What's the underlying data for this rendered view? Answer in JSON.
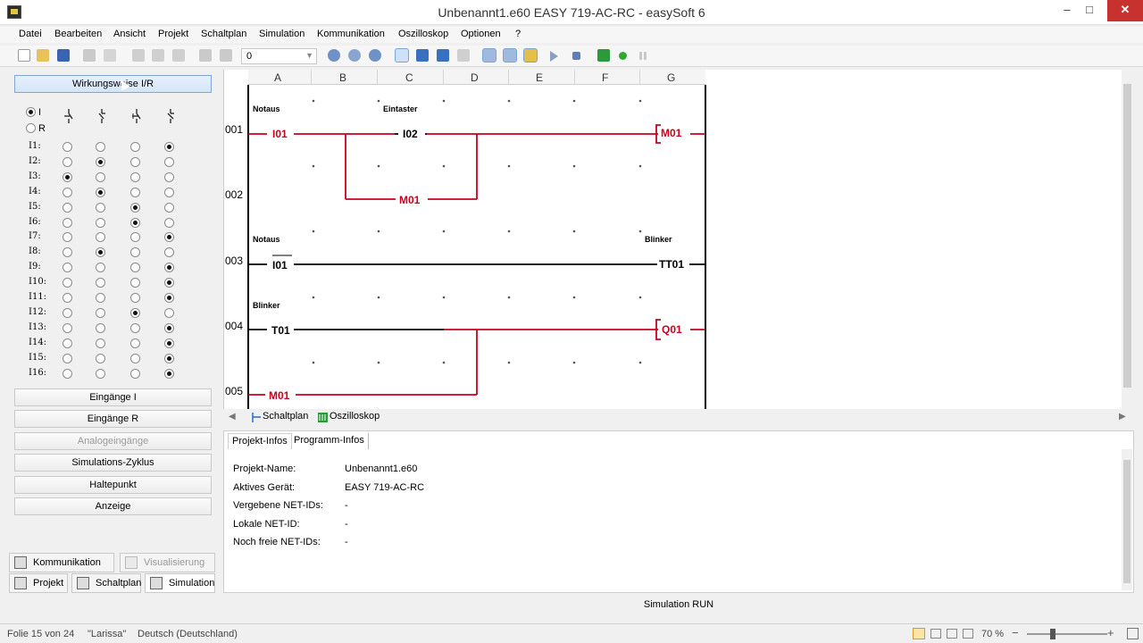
{
  "window": {
    "title": "Unbenannt1.e60 EASY 719-AC-RC - easySoft 6",
    "min": "–",
    "max": "□",
    "close": "✕"
  },
  "menu": [
    "Datei",
    "Bearbeiten",
    "Ansicht",
    "Projekt",
    "Schaltplan",
    "Simulation",
    "Kommunikation",
    "Oszilloskop",
    "Optionen",
    "?"
  ],
  "toolbar": {
    "combo_value": "0",
    "icons": [
      "new-file-icon",
      "open-folder-icon",
      "save-icon",
      "print-icon",
      "print-preview-icon",
      "cut-icon",
      "copy-icon",
      "paste-icon",
      "undo-icon",
      "redo-icon",
      "zoom-in-icon",
      "zoom-reset-icon",
      "zoom-out-icon",
      "contact-mode-icon",
      "contact-nc-icon",
      "contact-nb-icon",
      "function-block-icon",
      "grid-icon",
      "text-icon",
      "folder-icon",
      "play-icon",
      "stop-icon",
      "oscilloscope-icon",
      "record-icon",
      "pause-icon"
    ]
  },
  "sidebar": {
    "wirkungsweise_label": "Wirkungsweise I/R",
    "mode_i": "I",
    "mode_r": "R",
    "inputs": [
      {
        "label": "I1:",
        "selected": 3
      },
      {
        "label": "I2:",
        "selected": 1
      },
      {
        "label": "I3:",
        "selected": 0
      },
      {
        "label": "I4:",
        "selected": 1
      },
      {
        "label": "I5:",
        "selected": 2
      },
      {
        "label": "I6:",
        "selected": 2
      },
      {
        "label": "I7:",
        "selected": 3
      },
      {
        "label": "I8:",
        "selected": 1
      },
      {
        "label": "I9:",
        "selected": 3
      },
      {
        "label": "I10:",
        "selected": 3
      },
      {
        "label": "I11:",
        "selected": 3
      },
      {
        "label": "I12:",
        "selected": 2
      },
      {
        "label": "I13:",
        "selected": 3
      },
      {
        "label": "I14:",
        "selected": 3
      },
      {
        "label": "I15:",
        "selected": 3
      },
      {
        "label": "I16:",
        "selected": 3
      }
    ],
    "buttons": {
      "eingaenge_i": "Eingänge I",
      "eingaenge_r": "Eingänge R",
      "analog": "Analogeingänge",
      "zyklus": "Simulations-Zyklus",
      "haltepunkt": "Haltepunkt",
      "anzeige": "Anzeige"
    },
    "tabs": {
      "kommunikation": "Kommunikation",
      "visualisierung": "Visualisierung",
      "projekt": "Projekt",
      "schaltplan": "Schaltplan",
      "simulation": "Simulation"
    }
  },
  "diagram": {
    "columns": [
      "A",
      "B",
      "C",
      "D",
      "E",
      "F",
      "G"
    ],
    "rows": [
      "001",
      "002",
      "003",
      "004",
      "005"
    ],
    "labels": {
      "notaus1": "Notaus",
      "eintaster": "Eintaster",
      "notaus2": "Notaus",
      "blinker_top": "Blinker",
      "blinker_mid": "Blinker"
    },
    "contacts": {
      "i01a": "I01",
      "i02": "I02",
      "m01_row2": "M01",
      "i01b": "I01",
      "t01": "T01",
      "m01_row5": "M01"
    },
    "coils": {
      "m01": "M01",
      "tt01": "TT01",
      "q01": "Q01"
    },
    "active_color": "#c8001e"
  },
  "diagram_tabs": {
    "schaltplan": "Schaltplan",
    "oszilloskop": "Oszilloskop"
  },
  "info": {
    "tab_projekt": "Projekt-Infos",
    "tab_programm": "Programm-Infos",
    "rows": [
      {
        "label": "Projekt-Name:",
        "value": "Unbenannt1.e60"
      },
      {
        "label": "Aktives Gerät:",
        "value": "EASY 719-AC-RC"
      },
      {
        "label": "Vergebene NET-IDs:",
        "value": "-"
      },
      {
        "label": "Lokale NET-ID:",
        "value": "-"
      },
      {
        "label": "Noch freie NET-IDs:",
        "value": "-"
      }
    ]
  },
  "status": {
    "simulation": "Simulation RUN"
  },
  "taskbar": {
    "slide": "Folie 15 von 24",
    "theme": "\"Larissa\"",
    "language": "Deutsch (Deutschland)",
    "zoom": "70 %"
  }
}
